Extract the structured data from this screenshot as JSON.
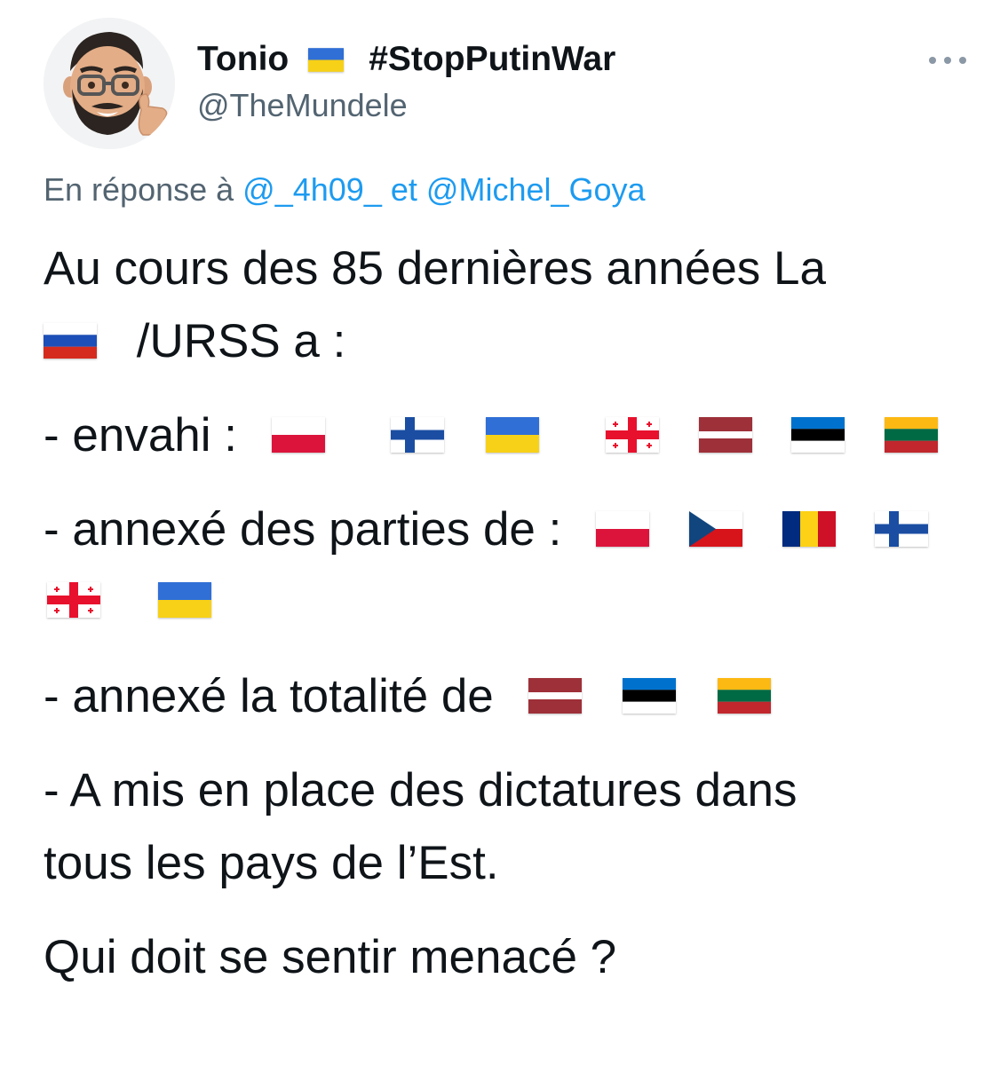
{
  "header": {
    "display_name": "Tonio",
    "hashtag": "#StopPutinWar",
    "handle": "@TheMundele",
    "name_flag_icon": "ukraine-flag-icon",
    "avatar_icon": "memoji-avatar"
  },
  "reply": {
    "prefix": "En réponse à",
    "mention1": "@_4h09_",
    "connector": "et",
    "mention2": "@Michel_Goya"
  },
  "tweet": {
    "line1": "Au cours des 85 dernières années La",
    "line2": "/URSS a :",
    "line3": "- envahi :",
    "line4": "- annexé des parties de :",
    "line6": "- annexé la totalité de",
    "line7": "- A mis en place des dictatures dans",
    "line8": "tous les pays de l’Est.",
    "line9": "Qui doit se sentir menacé ?"
  },
  "flags": {
    "line2": [
      "russia"
    ],
    "envahi": [
      "poland",
      "finland",
      "ukraine",
      "georgia",
      "latvia",
      "estonia",
      "lithuania"
    ],
    "annexe_parties": [
      "poland",
      "czechia",
      "romania",
      "finland",
      "georgia",
      "ukraine"
    ],
    "annexe_totalite": [
      "latvia",
      "estonia",
      "lithuania"
    ]
  },
  "colors": {
    "text": "#0f1419",
    "secondary": "#536471",
    "link": "#1d9bf0"
  }
}
